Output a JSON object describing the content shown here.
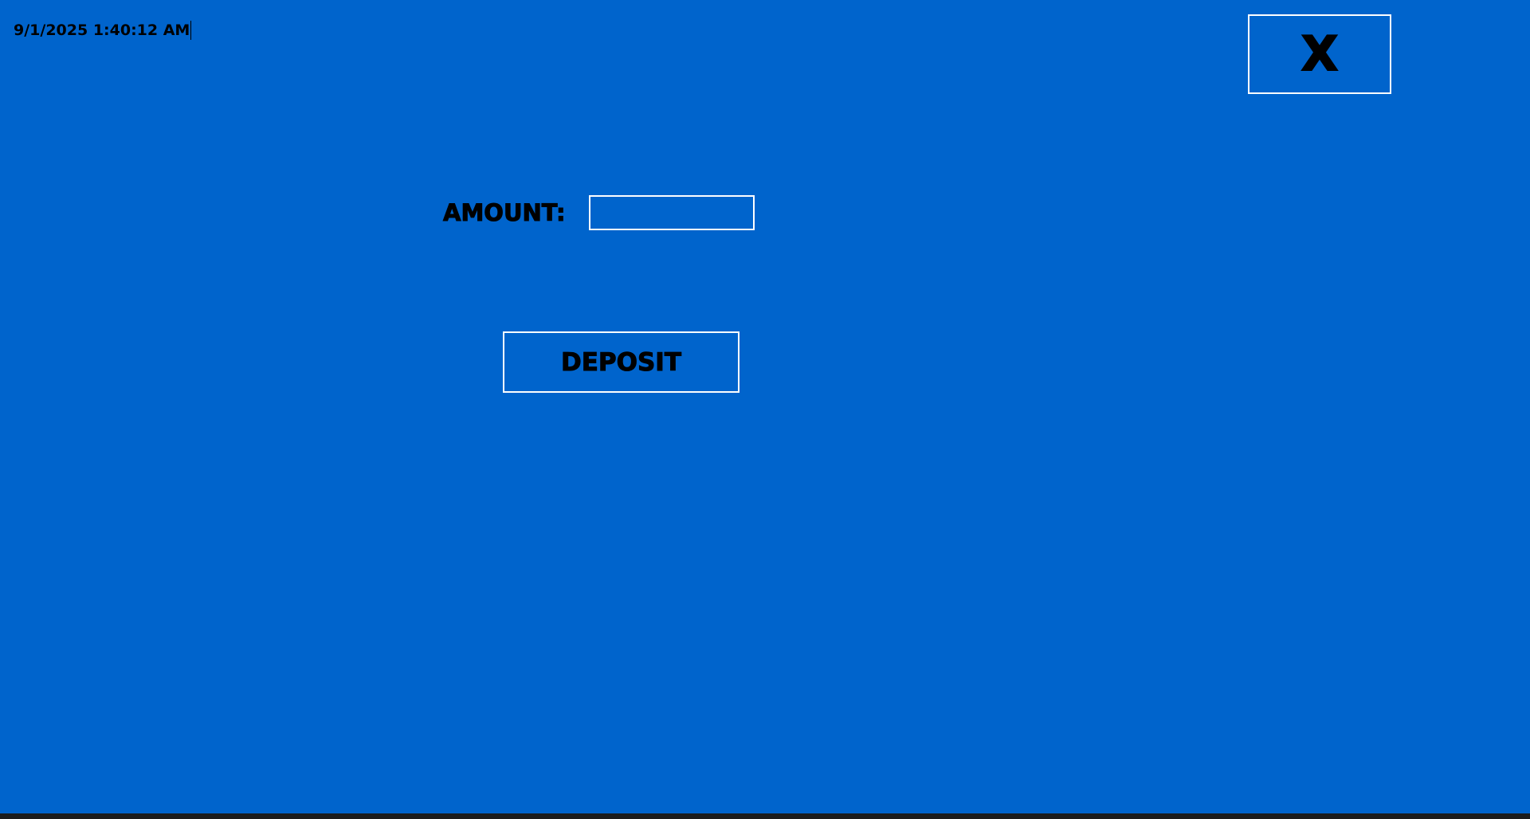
{
  "header": {
    "datetime": "9/1/2025 1:40:12 AM"
  },
  "window": {
    "close_label": "X"
  },
  "form": {
    "amount_label": "AMOUNT:",
    "amount_value": "",
    "deposit_label": "DEPOSIT"
  },
  "colors": {
    "background": "#0064cc",
    "border": "#ffffff",
    "text": "#000000"
  }
}
